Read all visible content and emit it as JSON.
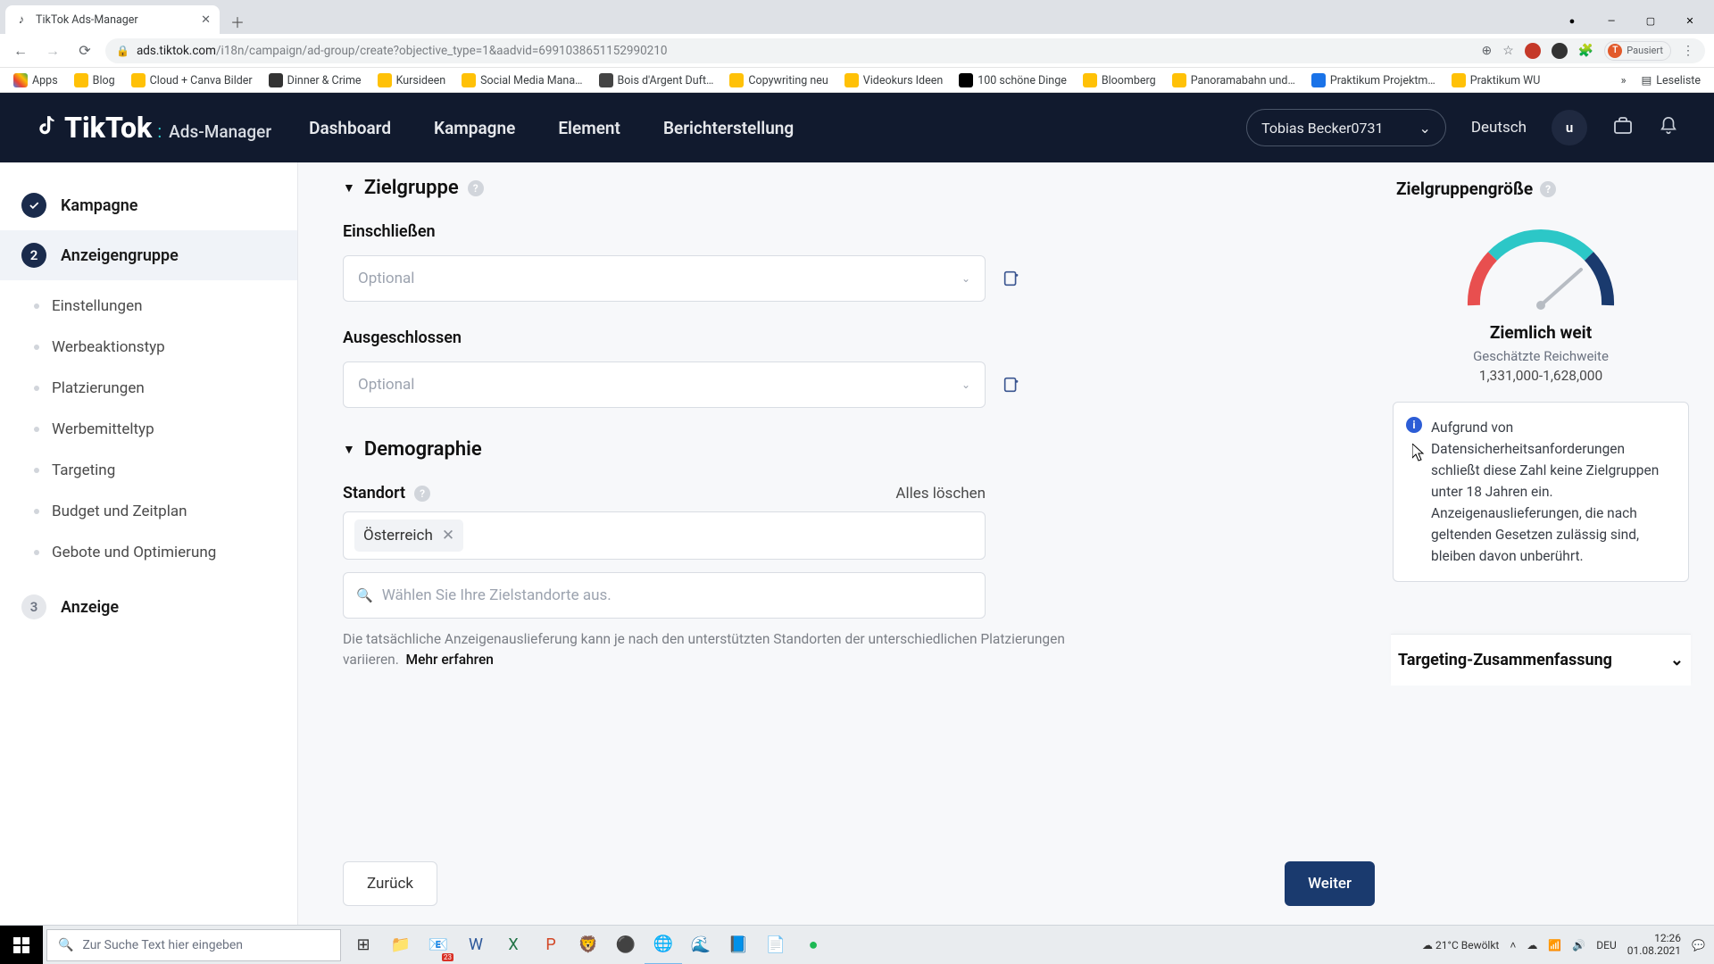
{
  "browser": {
    "tab_title": "TikTok Ads-Manager",
    "url_host": "ads.tiktok.com",
    "url_path": "/i18n/campaign/ad-group/create?objective_type=1&aadvid=6991038651152990210",
    "profile_label": "Pausiert",
    "profile_initial": "T",
    "bookmarks": [
      "Apps",
      "Blog",
      "Cloud + Canva Bilder",
      "Dinner & Crime",
      "Kursideen",
      "Social Media Mana…",
      "Bois d'Argent Duft…",
      "Copywriting neu",
      "Videokurs Ideen",
      "100 schöne Dinge",
      "Bloomberg",
      "Panoramabahn und…",
      "Praktikum Projektm…",
      "Praktikum WU"
    ],
    "reading_list": "Leseliste"
  },
  "header": {
    "brand_main": "TikTok",
    "brand_sub": "Ads-Manager",
    "nav": [
      "Dashboard",
      "Kampagne",
      "Element",
      "Berichterstellung"
    ],
    "account": "Tobias Becker0731",
    "language": "Deutsch",
    "avatar_initial": "u"
  },
  "sidebar": {
    "steps": [
      {
        "label": "Kampagne",
        "state": "done"
      },
      {
        "label": "Anzeigengruppe",
        "state": "active",
        "num": "2",
        "children": [
          "Einstellungen",
          "Werbeaktionstyp",
          "Platzierungen",
          "Werbemitteltyp",
          "Targeting",
          "Budget und Zeitplan",
          "Gebote und Optimierung"
        ]
      },
      {
        "label": "Anzeige",
        "state": "pending",
        "num": "3"
      }
    ]
  },
  "form": {
    "section_audience": "Zielgruppe",
    "include_label": "Einschließen",
    "exclude_label": "Ausgeschlossen",
    "optional_placeholder": "Optional",
    "section_demo": "Demographie",
    "location_label": "Standort",
    "clear_all": "Alles löschen",
    "location_tag": "Österreich",
    "location_search_placeholder": "Wählen Sie Ihre Zielstandorte aus.",
    "location_hint": "Die tatsächliche Anzeigenauslieferung kann je nach den unterstützten Standorten der unterschiedlichen Platzierungen variieren.",
    "location_more": "Mehr erfahren",
    "back": "Zurück",
    "next": "Weiter"
  },
  "rightpane": {
    "title": "Zielgruppengröße",
    "gauge_label": "Ziemlich weit",
    "reach_label": "Geschätzte Reichweite",
    "reach_value": "1,331,000-1,628,000",
    "info": "Aufgrund von Datensicherheitsanforderungen schließt diese Zahl keine Zielgruppen unter 18 Jahren ein. Anzeigenauslieferungen, die nach geltenden Gesetzen zulässig sind, bleiben davon unberührt.",
    "summary": "Targeting-Zusammenfassung"
  },
  "taskbar": {
    "search_placeholder": "Zur Suche Text hier eingeben",
    "weather": "21°C  Bewölkt",
    "lang": "DEU",
    "time": "12:26",
    "date": "01.08.2021"
  }
}
